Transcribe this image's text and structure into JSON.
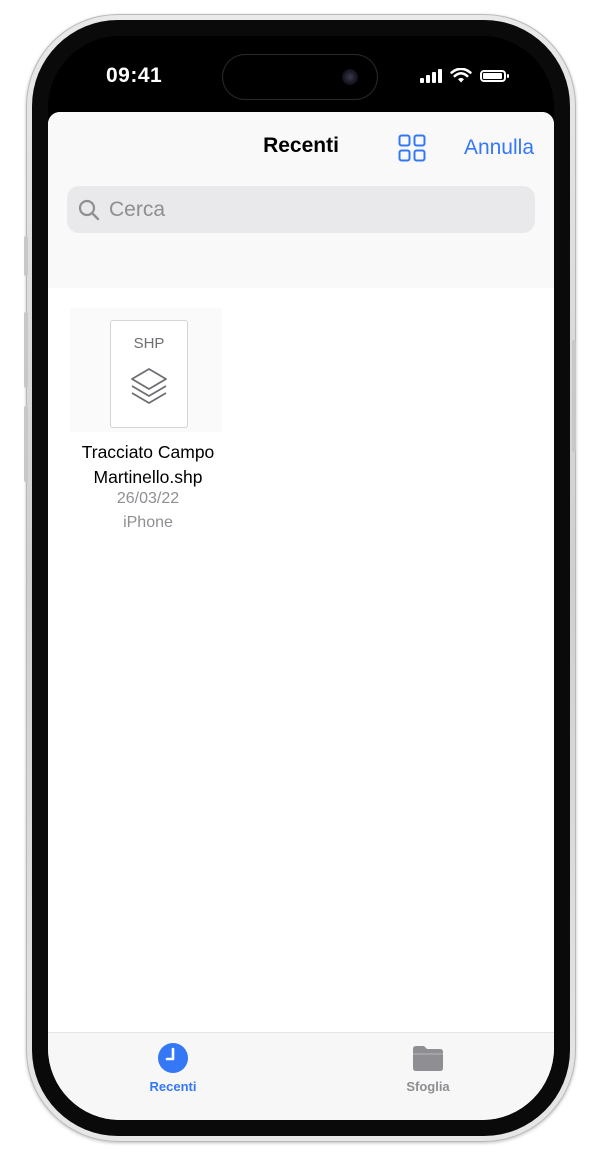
{
  "status_bar": {
    "time": "09:41"
  },
  "header": {
    "title": "Recenti",
    "cancel_label": "Annulla"
  },
  "search": {
    "placeholder": "Cerca"
  },
  "files": [
    {
      "type_label": "SHP",
      "name": "Tracciato Campo Martinello.shp",
      "date": "26/03/22",
      "location": "iPhone"
    }
  ],
  "tab_bar": {
    "tabs": [
      {
        "label": "Recenti",
        "icon": "clock-icon",
        "selected": true
      },
      {
        "label": "Sfoglia",
        "icon": "folder-icon",
        "selected": false
      }
    ]
  },
  "colors": {
    "accent": "#3478f6",
    "secondary_text": "#8e8e93",
    "search_background": "#e9e9eb"
  }
}
